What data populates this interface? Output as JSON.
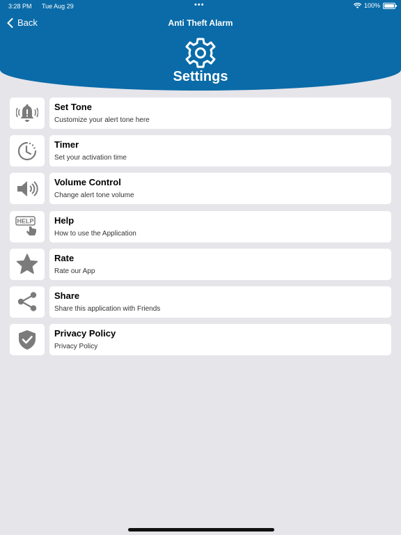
{
  "status_bar": {
    "time": "3:28 PM",
    "date": "Tue Aug 29",
    "dots": "•••",
    "battery": "100%"
  },
  "header": {
    "back_label": "Back",
    "app_title": "Anti Theft Alarm",
    "page_title": "Settings"
  },
  "icons": {
    "accent_color": "#0a6ba8",
    "icon_color": "#7b7b7b"
  },
  "settings_items": [
    {
      "title": "Set Tone",
      "subtitle": "Customize your alert tone here",
      "icon": "bell-alert-icon"
    },
    {
      "title": "Timer",
      "subtitle": "Set your activation time",
      "icon": "timer-icon"
    },
    {
      "title": "Volume Control",
      "subtitle": "Change alert tone volume",
      "icon": "speaker-volume-icon"
    },
    {
      "title": "Help",
      "subtitle": "How to use the Application",
      "icon": "help-icon",
      "icon_text": "HELP"
    },
    {
      "title": "Rate",
      "subtitle": "Rate our App",
      "icon": "star-icon"
    },
    {
      "title": "Share",
      "subtitle": "Share this application with Friends",
      "icon": "share-icon"
    },
    {
      "title": "Privacy Policy",
      "subtitle": "Privacy Policy",
      "icon": "shield-check-icon"
    }
  ]
}
